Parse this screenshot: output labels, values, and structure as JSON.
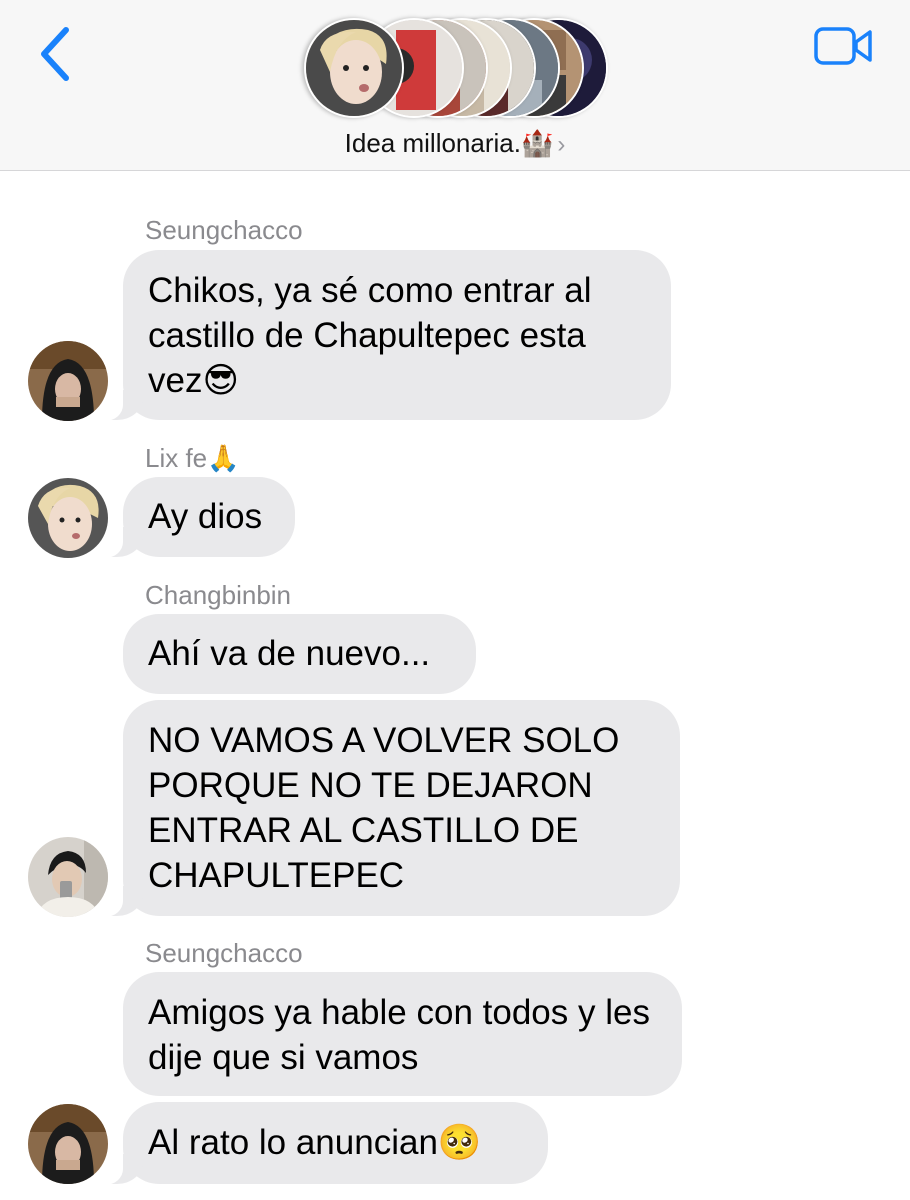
{
  "header": {
    "back_icon": "chevron-left-icon",
    "video_icon": "video-camera-icon",
    "group_name": "Idea millonaria.🏰",
    "chevron": "›",
    "accent_color": "#1a82fb"
  },
  "messages": [
    {
      "sender": "Seungchacco",
      "text": "Chikos, ya sé como entrar al castillo de Chapultepec esta vez😎"
    },
    {
      "sender": "Lix fe🙏",
      "text": "Ay dios"
    },
    {
      "sender": "Changbinbin",
      "text": "Ahí va de nuevo..."
    },
    {
      "text": "NO VAMOS A VOLVER SOLO PORQUE NO TE DEJARON ENTRAR AL CASTILLO DE CHAPULTEPEC"
    },
    {
      "sender": "Seungchacco",
      "text": "Amigos ya hable con todos y les dije que si vamos"
    },
    {
      "text": "Al rato lo anuncian🥺"
    }
  ],
  "colors": {
    "bubble": "#e9e9eb",
    "sender_text": "#8a8a8e"
  }
}
